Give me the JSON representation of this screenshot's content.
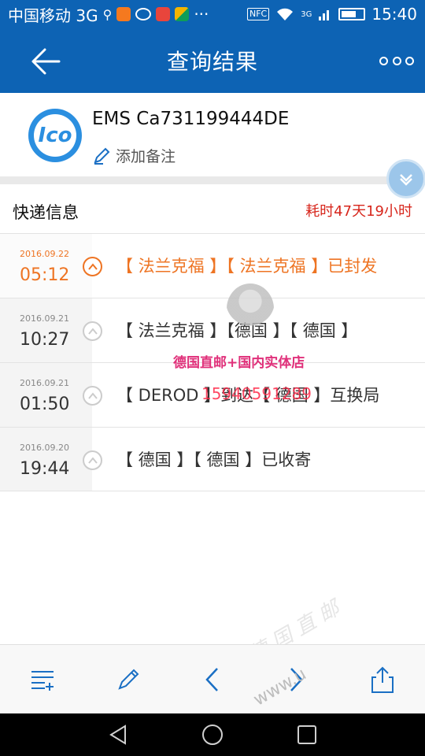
{
  "status_bar": {
    "carrier": "中国移动 3G",
    "time": "15:40",
    "nfc_label": "NFC",
    "network_label": "3G"
  },
  "header": {
    "title": "查询结果",
    "back_icon": "back-arrow-icon",
    "more_icon": "more-dots-icon"
  },
  "summary": {
    "courier_logo_text": "Ico",
    "tracking_number": "EMS Ca731199444DE",
    "note_label": "添加备注"
  },
  "section": {
    "title": "快递信息",
    "duration": "耗时47天19小时"
  },
  "timeline": [
    {
      "date": "2016.09.22",
      "time": "05:12",
      "text": "【 法兰克福 】【 法兰克福 】已封发",
      "active": true
    },
    {
      "date": "2016.09.21",
      "time": "10:27",
      "text": "【 法兰克福 】【德国 】【 德国 】"
    },
    {
      "date": "2016.09.21",
      "time": "01:50",
      "text": "【 DEROD 】到达【 德国 】互换局"
    },
    {
      "date": "2016.09.20",
      "time": "19:44",
      "text": "【 德国 】【 德国 】已收寄"
    }
  ],
  "watermark": {
    "shop_text": "德国直邮+国内实体店",
    "phone": "15940591289",
    "site": "www.u",
    "brand": "德国直邮"
  },
  "colors": {
    "primary": "#0d63b4",
    "accent_orange": "#ee7423",
    "duration_red": "#d7261c"
  },
  "toolbar": {
    "icons": [
      "list-add-icon",
      "pencil-icon",
      "chevron-left-icon",
      "chevron-right-icon",
      "share-icon"
    ]
  }
}
